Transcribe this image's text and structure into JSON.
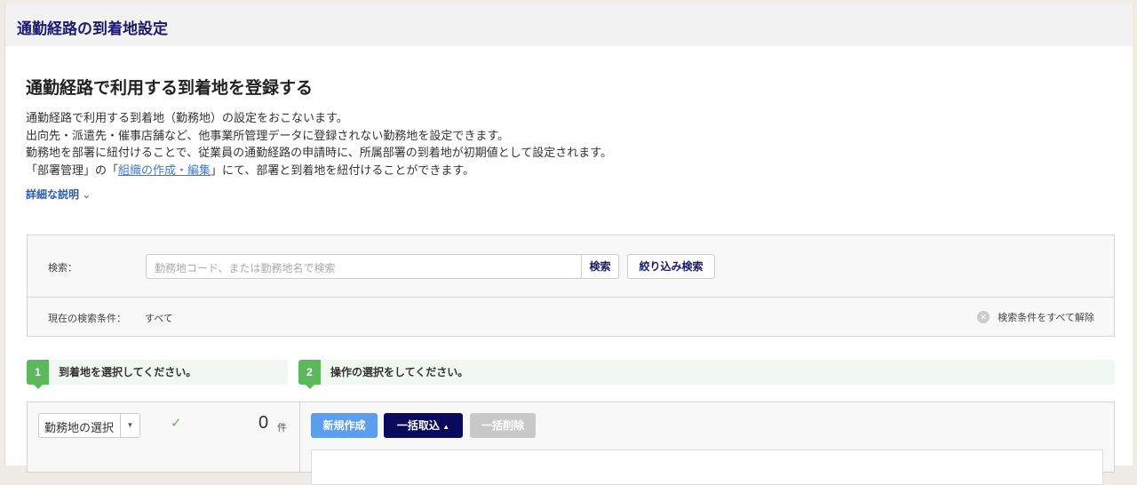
{
  "header": {
    "title": "通勤経路の到着地設定"
  },
  "main": {
    "heading": "通勤経路で利用する到着地を登録する",
    "description": [
      "通勤経路で利用する到着地（勤務地）の設定をおこないます。",
      "出向先・派遣先・催事店舗など、他事業所管理データに登録されない勤務地を設定できます。",
      "勤務地を部署に紐付けることで、従業員の通勤経路の申請時に、所属部署の到着地が初期値として設定されます。"
    ],
    "desc_line4_pre": "「部署管理」の「",
    "desc_line4_link": "組織の作成・編集",
    "desc_line4_post": "」にて、部署と到着地を紐付けることができます。",
    "details_toggle": "詳細な説明"
  },
  "search": {
    "label": "検索：",
    "placeholder": "勤務地コード、または勤務地名で検索",
    "search_button": "検索",
    "filter_button": "絞り込み検索",
    "current_label": "現在の検索条件：",
    "current_value": "すべて",
    "clear_all": "検索条件をすべて解除"
  },
  "steps": [
    {
      "num": "1",
      "label": "到着地を選択してください。"
    },
    {
      "num": "2",
      "label": "操作の選択をしてください。"
    }
  ],
  "selection": {
    "select_label": "勤務地の選択",
    "count": "0",
    "unit": "件"
  },
  "actions": {
    "new": "新規作成",
    "import": "一括取込",
    "delete": "一括削除"
  },
  "colors": {
    "accent_navy": "#0a0a5c",
    "primary_blue": "#5b9def",
    "step_green": "#5cb85c",
    "disabled": "#c8c8c8"
  }
}
